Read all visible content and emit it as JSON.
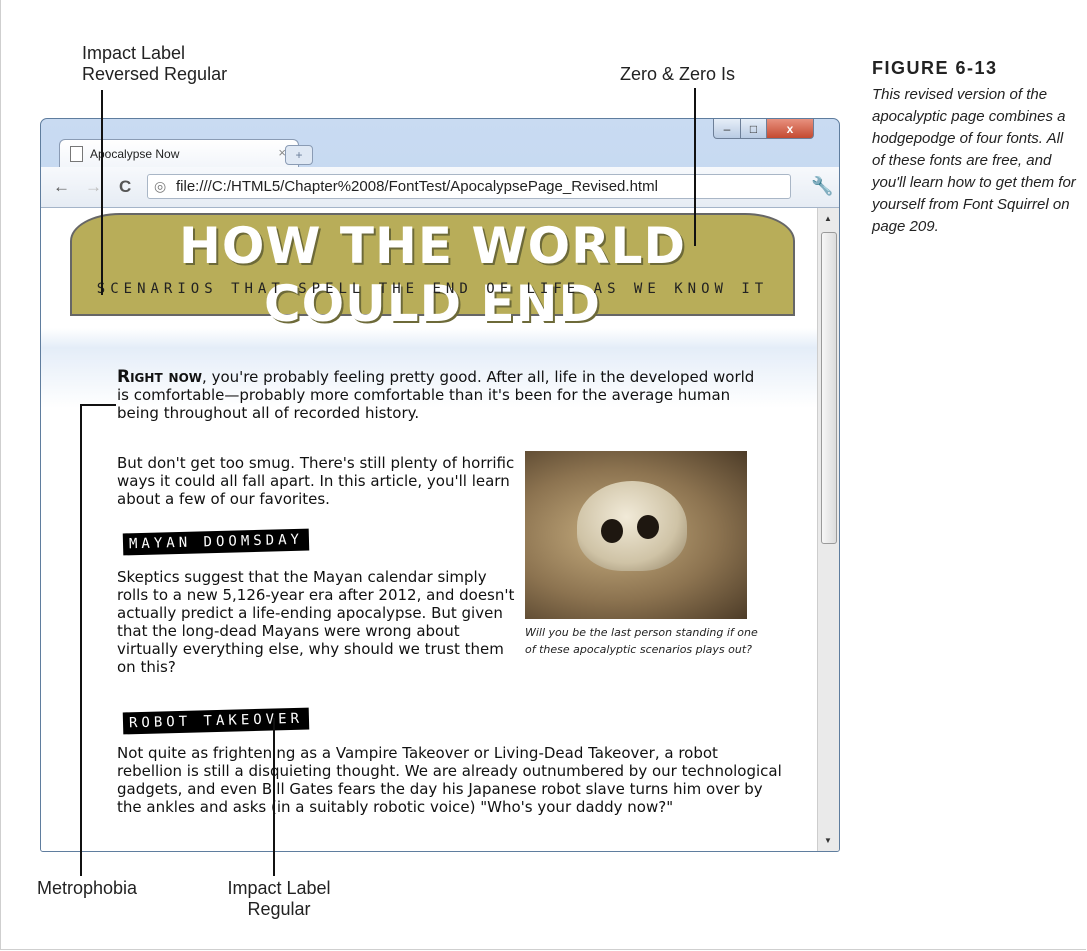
{
  "callouts": {
    "impact_label_reversed": [
      "Impact Label",
      "Reversed Regular"
    ],
    "zero_and_zero_is": "Zero & Zero Is",
    "metrophobia": "Metrophobia",
    "impact_label_regular": [
      "Impact Label",
      "Regular"
    ]
  },
  "figure": {
    "label": "FIGURE 6-13",
    "caption": "This revised version of the apocalyptic page combines a hodgepodge of four fonts. All of these fonts are free, and you'll learn how to get them for yourself from Font Squirrel on page 209."
  },
  "browser": {
    "tab_title": "Apocalypse Now",
    "tab_close": "×",
    "new_tab": "+",
    "min": "–",
    "max": "□",
    "close": "x",
    "back": "←",
    "forward": "→",
    "reload": "C",
    "url": "file:///C:/HTML5/Chapter%2008/FontTest/ApocalypsePage_Revised.html",
    "wrench": "🔧"
  },
  "page": {
    "banner_title": "HOW THE WORLD COULD END",
    "banner_subtitle": "SCENARIOS THAT SPELL THE END OF LIFE AS WE KNOW IT",
    "lead_word": "Right now",
    "para1_rest": ", you're probably feeling pretty good. After all, life in the developed world is comfortable—probably more comfortable than it's been for the average human being throughout all of recorded history.",
    "para2": "But don't get too smug. There's still plenty of horrific ways it could all fall apart. In this article, you'll learn about a few of our favorites.",
    "heading_mayan": "MAYAN DOOMSDAY",
    "para_mayan": "Skeptics suggest that the Mayan calendar simply rolls to a new 5,126-year era after 2012, and doesn't actually predict a life-ending apocalypse. But given that the long-dead Mayans were wrong about virtually everything else, why should we trust them on this?",
    "image_caption": "Will you be the last person standing if one of these apocalyptic scenarios plays out?",
    "heading_robot": "ROBOT TAKEOVER",
    "para_robot": "Not quite as frightening as a Vampire Takeover or Living-Dead Takeover, a robot rebellion is still a disquieting thought. We are already outnumbered by our technological gadgets, and even Bill Gates fears the day his Japanese robot slave turns him over by the ankles and asks (in a suitably robotic voice) \"Who's your daddy now?\""
  }
}
